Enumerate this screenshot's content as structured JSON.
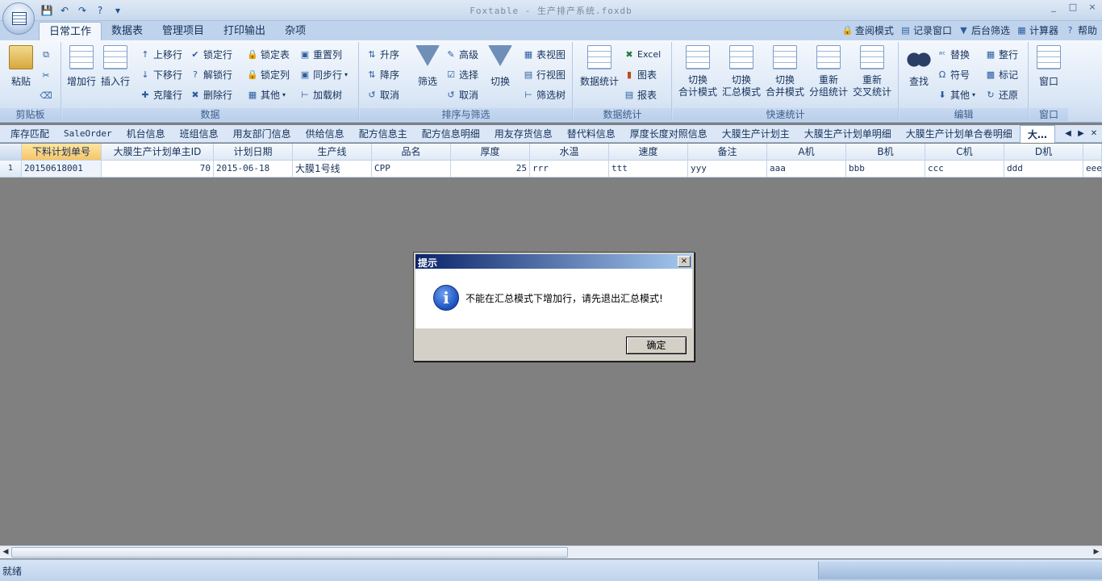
{
  "window": {
    "title": "Foxtable - 生产排产系统.foxdb",
    "controls": [
      "_",
      "□",
      "×"
    ]
  },
  "quick_access": [
    "💾",
    "↶",
    "↷",
    "?",
    "▾"
  ],
  "ribbon_tabs": [
    "日常工作",
    "数据表",
    "管理项目",
    "打印输出",
    "杂项"
  ],
  "right_tools": [
    {
      "icon": "🔒",
      "label": "查阅模式"
    },
    {
      "icon": "▤",
      "label": "记录窗口"
    },
    {
      "icon": "▼",
      "label": "后台筛选"
    },
    {
      "icon": "▦",
      "label": "计算器"
    },
    {
      "icon": "?",
      "label": "帮助"
    }
  ],
  "groups": {
    "clipboard": {
      "label": "剪贴板",
      "paste": "粘贴"
    },
    "data": {
      "label": "数据",
      "add_row": "增加行",
      "insert_row": "插入行",
      "small": [
        "上移行",
        "下移行",
        "克隆行",
        "锁定行",
        "解锁行",
        "删除行",
        "锁定表",
        "锁定列",
        "其他",
        "重置列",
        "同步行",
        "加载树"
      ]
    },
    "sort_filter": {
      "label": "排序与筛选",
      "small": [
        "升序",
        "降序",
        "取消",
        "高级",
        "选择",
        "取消"
      ],
      "filter": "筛选",
      "switch": "切换"
    },
    "views": {
      "small": [
        "表视图",
        "行视图",
        "筛选树"
      ]
    },
    "stats": {
      "label": "数据统计",
      "big": "数据统计",
      "small": [
        "Excel",
        "图表",
        "报表"
      ]
    },
    "quick_stats": {
      "label": "快速统计",
      "buttons": [
        [
          "切换",
          "合计模式"
        ],
        [
          "切换",
          "汇总模式"
        ],
        [
          "切换",
          "合并模式"
        ],
        [
          "重新",
          "分组统计"
        ],
        [
          "重新",
          "交叉统计"
        ]
      ]
    },
    "edit": {
      "label": "编辑",
      "find": "查找",
      "small": [
        "替换",
        "符号",
        "其他",
        "整行",
        "标记",
        "还原"
      ]
    },
    "window": {
      "label": "窗口",
      "big": "窗口"
    }
  },
  "sheet_tabs": [
    "库存匹配",
    "SaleOrder",
    "机台信息",
    "班组信息",
    "用友部门信息",
    "供给信息",
    "配方信息主",
    "配方信息明细",
    "用友存货信息",
    "替代料信息",
    "厚度长度对照信息",
    "大膜生产计划主",
    "大膜生产计划单明细",
    "大膜生产计划单合卷明细",
    "大…"
  ],
  "table": {
    "columns": [
      "下料计划单号",
      "大膜生产计划单主ID",
      "计划日期",
      "生产线",
      "品名",
      "厚度",
      "水温",
      "速度",
      "备注",
      "A机",
      "B机",
      "C机",
      "D机"
    ],
    "rows": [
      {
        "no": "1",
        "cells": [
          "20150618001",
          "70",
          "2015-06-18",
          "大膜1号线",
          "CPP",
          "25",
          "rrr",
          "ttt",
          "yyy",
          "aaa",
          "bbb",
          "ccc",
          "ddd",
          "eee"
        ]
      }
    ]
  },
  "status": {
    "text": "就绪"
  },
  "dialog": {
    "title": "提示",
    "close": "×",
    "icon": "i",
    "message": "不能在汇总模式下增加行，请先退出汇总模式!",
    "ok": "确定"
  }
}
